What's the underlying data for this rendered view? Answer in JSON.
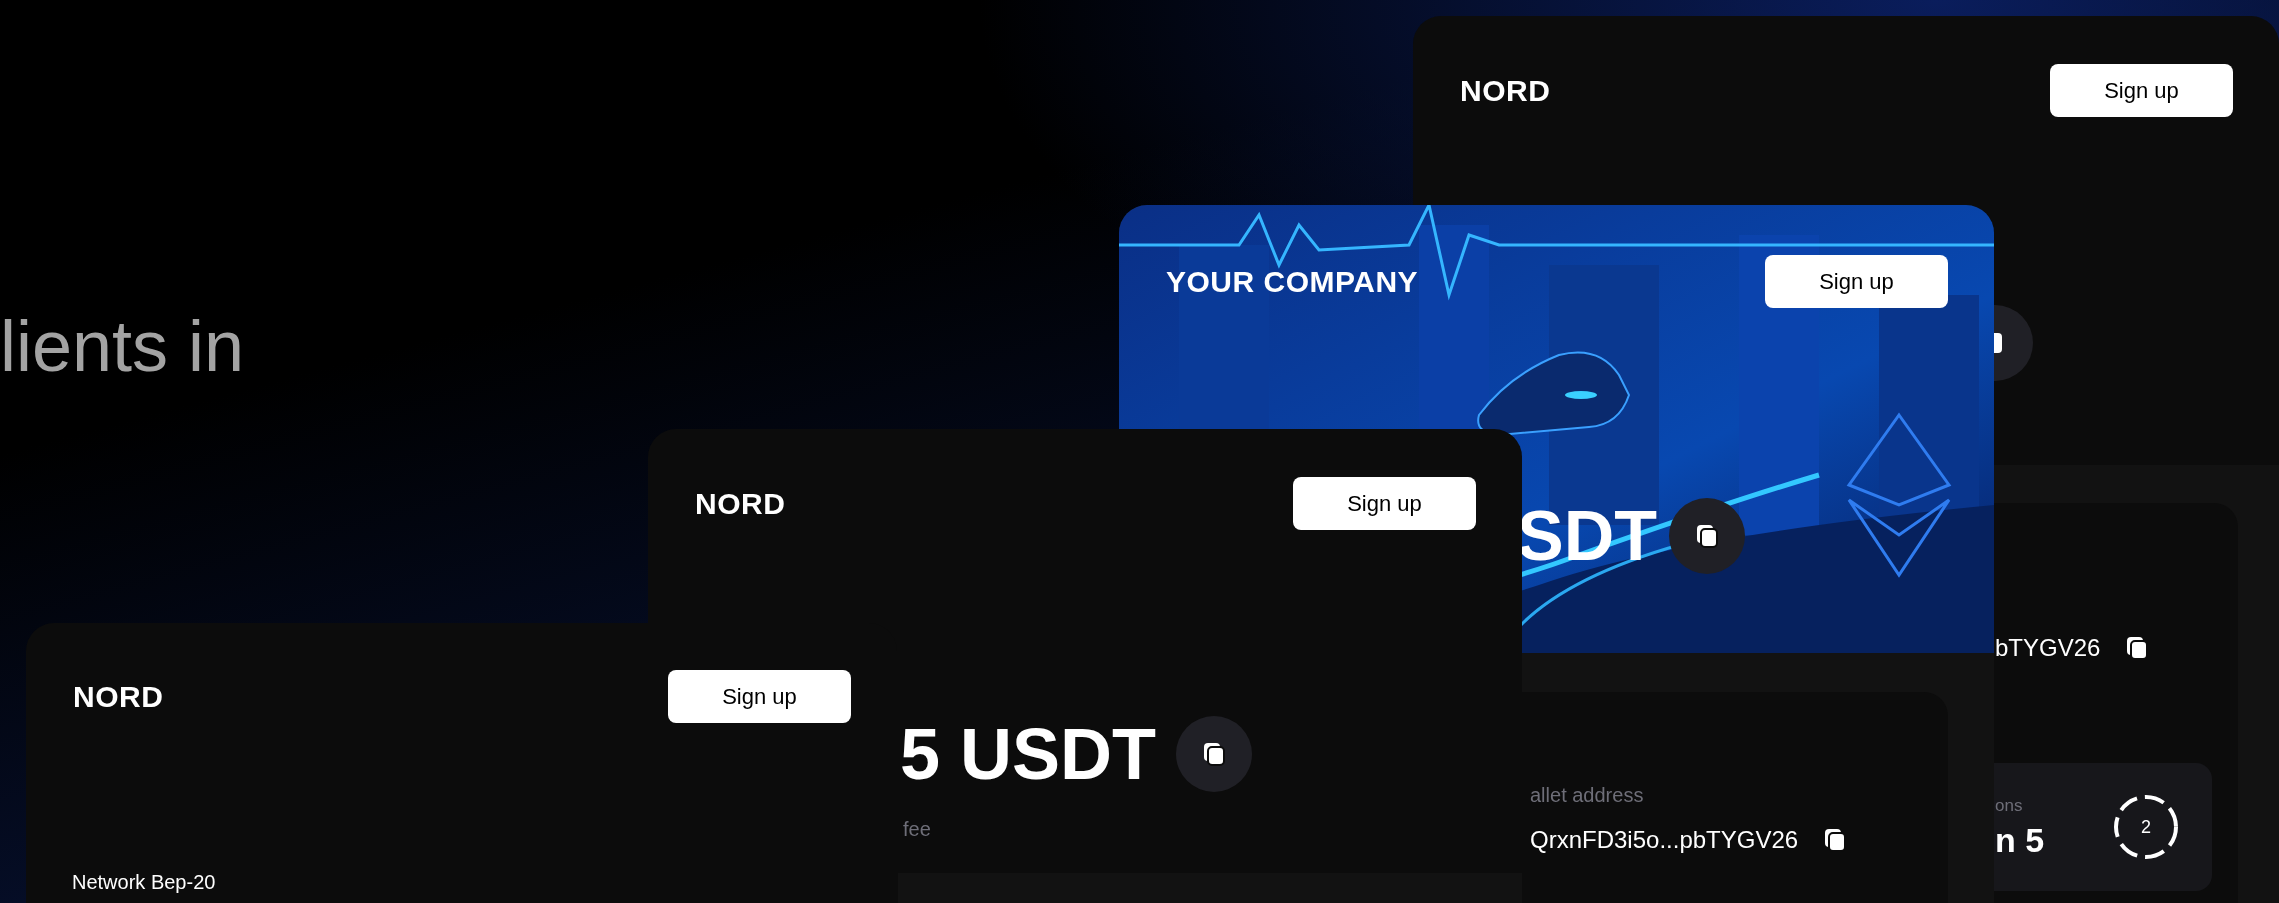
{
  "headline": "lients in",
  "cards": [
    {
      "kind": "wallet_summary",
      "brand": "NORD",
      "button": "Sign up",
      "address": "bTYGV26",
      "counter": {
        "label": "ons",
        "value": "n 5",
        "ring": "2"
      }
    },
    {
      "kind": "picture_header",
      "brand": "YOUR COMPANY",
      "button": "Sign up",
      "amount": "SDT",
      "wallet": {
        "label": "allet address",
        "address": "QrxnFD3i5o...pbTYGV26"
      }
    },
    {
      "kind": "fee",
      "brand": "NORD",
      "button": "Sign up",
      "amount": "5 USDT",
      "caption": "fee"
    },
    {
      "kind": "network",
      "brand": "NORD",
      "button": "Sign up",
      "network": "Network Bep-20"
    }
  ]
}
